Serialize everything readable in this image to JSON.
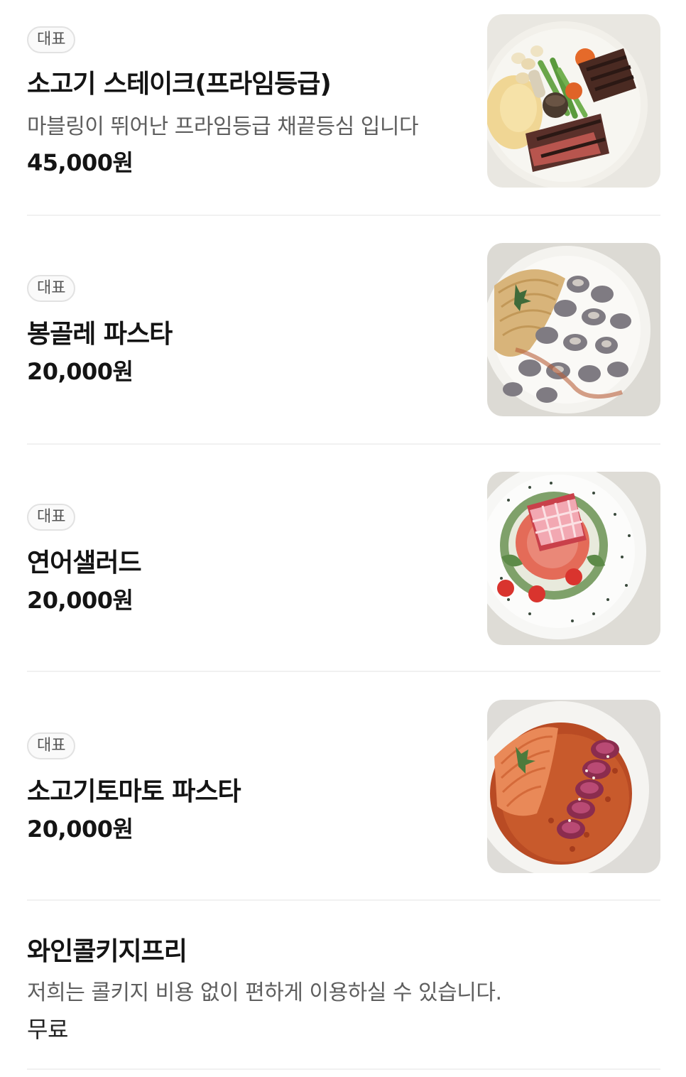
{
  "menu": {
    "items": [
      {
        "badge": "대표",
        "name": "소고기 스테이크(프라임등급)",
        "description": "마블링이 뛰어난 프라임등급 채끝등심 입니다",
        "price": "45,000원",
        "photo_icon": "steak-dish-photo"
      },
      {
        "badge": "대표",
        "name": "봉골레 파스타",
        "price": "20,000원",
        "photo_icon": "vongole-pasta-photo"
      },
      {
        "badge": "대표",
        "name": "연어샐러드",
        "price": "20,000원",
        "photo_icon": "salmon-salad-photo"
      },
      {
        "badge": "대표",
        "name": "소고기토마토 파스타",
        "price": "20,000원",
        "photo_icon": "beef-tomato-pasta-photo"
      },
      {
        "name": "와인콜키지프리",
        "description": "저희는 콜키지 비용 없이 편하게 이용하실 수 있습니다.",
        "price": "무료"
      }
    ]
  },
  "colors": {
    "text_primary": "#141414",
    "text_secondary": "#5e5e5e",
    "badge_border": "#e2e2e2",
    "divider": "#f1f1f1"
  }
}
